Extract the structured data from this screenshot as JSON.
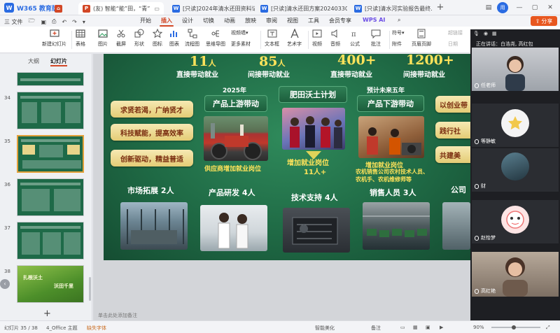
{
  "tabs": {
    "brand": "W365 教育版",
    "items": [
      {
        "label": "(友) 智能“能”田，“青”",
        "icon": "P",
        "color": "#d24726"
      },
      {
        "label": "[只读]2024年清水还田资料记录(1).d",
        "icon": "W",
        "color": "#2a6be2"
      },
      {
        "label": "[只读]清水还田方案20240330.docx",
        "icon": "W",
        "color": "#2a6be2"
      },
      {
        "label": "[只读]清水河实验报告最终.docx",
        "icon": "W",
        "color": "#2a6be2"
      }
    ]
  },
  "menu": {
    "file": "三 文件",
    "items": [
      "开始",
      "插入",
      "设计",
      "切换",
      "动画",
      "放映",
      "审阅",
      "视图",
      "工具",
      "会员专享"
    ],
    "active": "插入",
    "wps_ai": "WPS AI",
    "share": "分享"
  },
  "ribbon": {
    "items": [
      "新建幻灯片",
      "表格",
      "图片",
      "截屏",
      "形状",
      "图标",
      "图表",
      "流程图",
      "思维导图",
      "智能图形",
      "更多素材",
      "文本框",
      "艺术字",
      "视频",
      "音频",
      "公式",
      "批注",
      "页眉页脚",
      "对象"
    ],
    "small": [
      "视频墙▾",
      "思维导图▾",
      "符号▾",
      "附件",
      "超链接",
      "日期"
    ]
  },
  "left_panel": {
    "tabs": [
      "大纲",
      "幻灯片"
    ],
    "active_tab": "幻灯片",
    "slide_numbers": [
      "34",
      "35",
      "36",
      "37",
      "38"
    ],
    "thumb_caption_a": "扎根沃土",
    "thumb_caption_b": "沃田千里",
    "add": "+"
  },
  "slide": {
    "stats": [
      {
        "num": "11",
        "unit": "人",
        "label": "直接带动就业"
      },
      {
        "num": "85",
        "unit": "人",
        "label": "间接带动就业"
      },
      {
        "num": "400+",
        "unit": "",
        "label": "直接带动就业"
      },
      {
        "num": "1200+",
        "unit": "",
        "label": "间接带动就业"
      }
    ],
    "year_left": "2025年",
    "year_right": "预计未来五年",
    "left_pills": [
      "求贤若渴，广纳贤才",
      "科技赋能，提高效率",
      "创新驱动，精益普适"
    ],
    "right_pills": [
      "以创业带",
      "践行社",
      "共建美"
    ],
    "headers": [
      "产品上游带动",
      "肥田沃土计划",
      "产品下游带动"
    ],
    "upstream_caption": "供应商增加就业岗位",
    "center_caption_1": "增加就业岗位",
    "center_caption_2": "11人+",
    "downstream_caption_1": "增加就业岗位",
    "downstream_caption_2": "农机销售公司农村技术人员、",
    "downstream_caption_3": "农机手、农机维修师等",
    "roles": [
      "市场拓展 2人",
      "产品研发 4人",
      "技术支持 4人",
      "销售人员 3人",
      "公司"
    ]
  },
  "notes": "单击此处添加备注",
  "meeting": {
    "speaking": "正在讲话：白浩尧, 高红包",
    "participants": [
      "任老师",
      "等静敏",
      "财",
      "赵怡梦",
      "高红艳"
    ]
  },
  "status": {
    "slide_pos": "幻灯片 35 / 38",
    "theme": "4_Office 主题",
    "font_missing": "缺失字体",
    "smart_beautify": "智能美化",
    "notes_btn": "备注",
    "zoom": "90%",
    "zoom_fraction": 0.45
  }
}
